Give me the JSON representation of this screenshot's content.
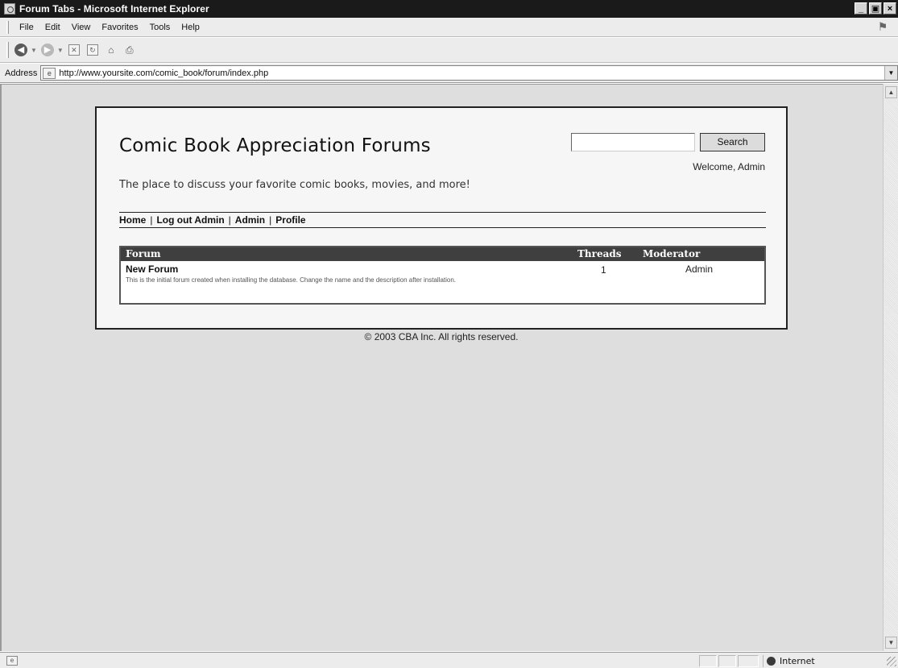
{
  "window": {
    "title": "Forum Tabs - Microsoft Internet Explorer",
    "minimize_glyph": "_",
    "maximize_glyph": "▣",
    "close_glyph": "×"
  },
  "menu": {
    "items": [
      "File",
      "Edit",
      "View",
      "Favorites",
      "Tools",
      "Help"
    ]
  },
  "toolbar": {
    "icons": [
      "back-icon",
      "forward-icon",
      "stop-icon",
      "refresh-icon",
      "home-icon",
      "print-icon"
    ]
  },
  "address_bar": {
    "label": "Address",
    "url": "http://www.yoursite.com/comic_book/forum/index.php"
  },
  "page": {
    "site_title": "Comic Book Appreciation Forums",
    "tagline": "The place to discuss your favorite comic books, movies, and more!",
    "search_button": "Search",
    "search_value": "",
    "welcome": "Welcome, Admin",
    "nav": [
      "Home",
      "Log out Admin",
      "Admin",
      "Profile"
    ],
    "nav_separator": "|",
    "forum_table": {
      "headers": {
        "forum": "Forum",
        "threads": "Threads",
        "moderator": "Moderator"
      },
      "rows": [
        {
          "name": "New Forum",
          "description": "This is the initial forum created when installing the database. Change the name and the description after installation.",
          "threads": "1",
          "moderator": "Admin"
        }
      ]
    },
    "footer": "© 2003 CBA Inc. All rights reserved."
  },
  "status_bar": {
    "zone": "Internet"
  },
  "colors": {
    "titlebar": "#1a1a1a",
    "table_header": "#3f3f3f",
    "viewport_bg": "#dedede"
  }
}
